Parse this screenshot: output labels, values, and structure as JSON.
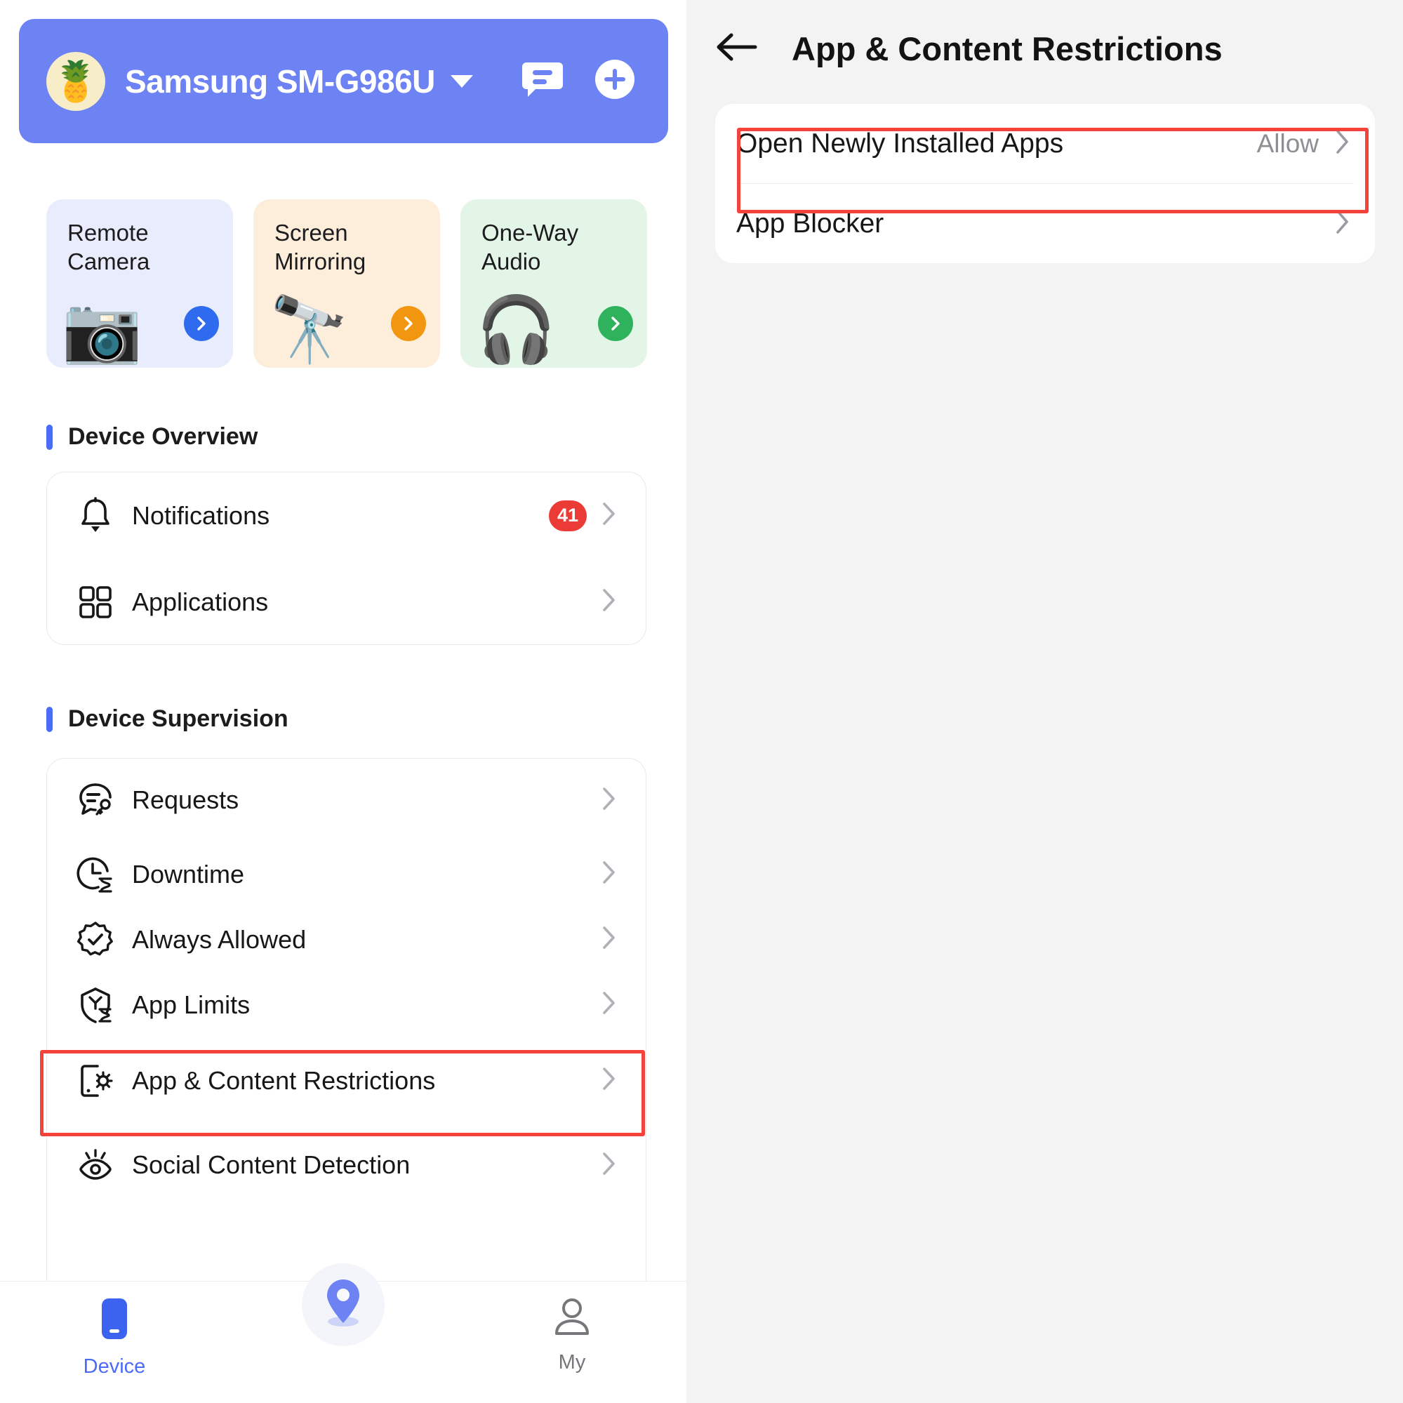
{
  "left": {
    "header": {
      "avatar_emoji": "🍍",
      "device_name": "Samsung SM-G986U",
      "caret_icon": "chevron-down-icon",
      "chat_icon": "chat-bubble-icon",
      "add_icon": "plus-circle-icon"
    },
    "cards": [
      {
        "title": "Remote Camera",
        "emoji": "📷",
        "arrow_color": "#2f6bee",
        "bg": "#e8ecfd"
      },
      {
        "title": "Screen Mirroring",
        "emoji": "🔭",
        "arrow_color": "#f2960f",
        "bg": "#fdeedb"
      },
      {
        "title": "One-Way Audio",
        "emoji": "🎧",
        "arrow_color": "#2eb35c",
        "bg": "#e2f5e6"
      }
    ],
    "sections": [
      {
        "title": "Device Overview",
        "items": [
          {
            "label": "Notifications",
            "icon": "bell-icon",
            "badge": "41"
          },
          {
            "label": "Applications",
            "icon": "grid-apps-icon",
            "badge": ""
          }
        ]
      },
      {
        "title": "Device Supervision",
        "items": [
          {
            "label": "Requests",
            "icon": "speech-bubble-key-icon",
            "badge": ""
          },
          {
            "label": "Downtime",
            "icon": "clock-hourglass-icon",
            "badge": ""
          },
          {
            "label": "Always Allowed",
            "icon": "badge-check-icon",
            "badge": ""
          },
          {
            "label": "App Limits",
            "icon": "shield-hourglass-icon",
            "badge": ""
          },
          {
            "label": "App & Content Restrictions",
            "icon": "phone-gear-icon",
            "badge": ""
          },
          {
            "label": "Social Content Detection",
            "icon": "eye-icon",
            "badge": ""
          }
        ]
      }
    ],
    "bottom_nav": [
      {
        "label": "Device",
        "icon": "phone-icon",
        "active": true
      },
      {
        "label": "",
        "icon": "location-pin-icon",
        "active": false
      },
      {
        "label": "My",
        "icon": "person-icon",
        "active": false
      }
    ]
  },
  "right": {
    "back_icon": "arrow-left-icon",
    "title": "App & Content Restrictions",
    "rows": [
      {
        "label": "Open Newly Installed Apps",
        "value": "Allow",
        "chevron": "chevron-right-icon"
      },
      {
        "label": "App Blocker",
        "value": "",
        "chevron": "chevron-right-icon"
      }
    ]
  },
  "highlight_color": "#f4423c"
}
